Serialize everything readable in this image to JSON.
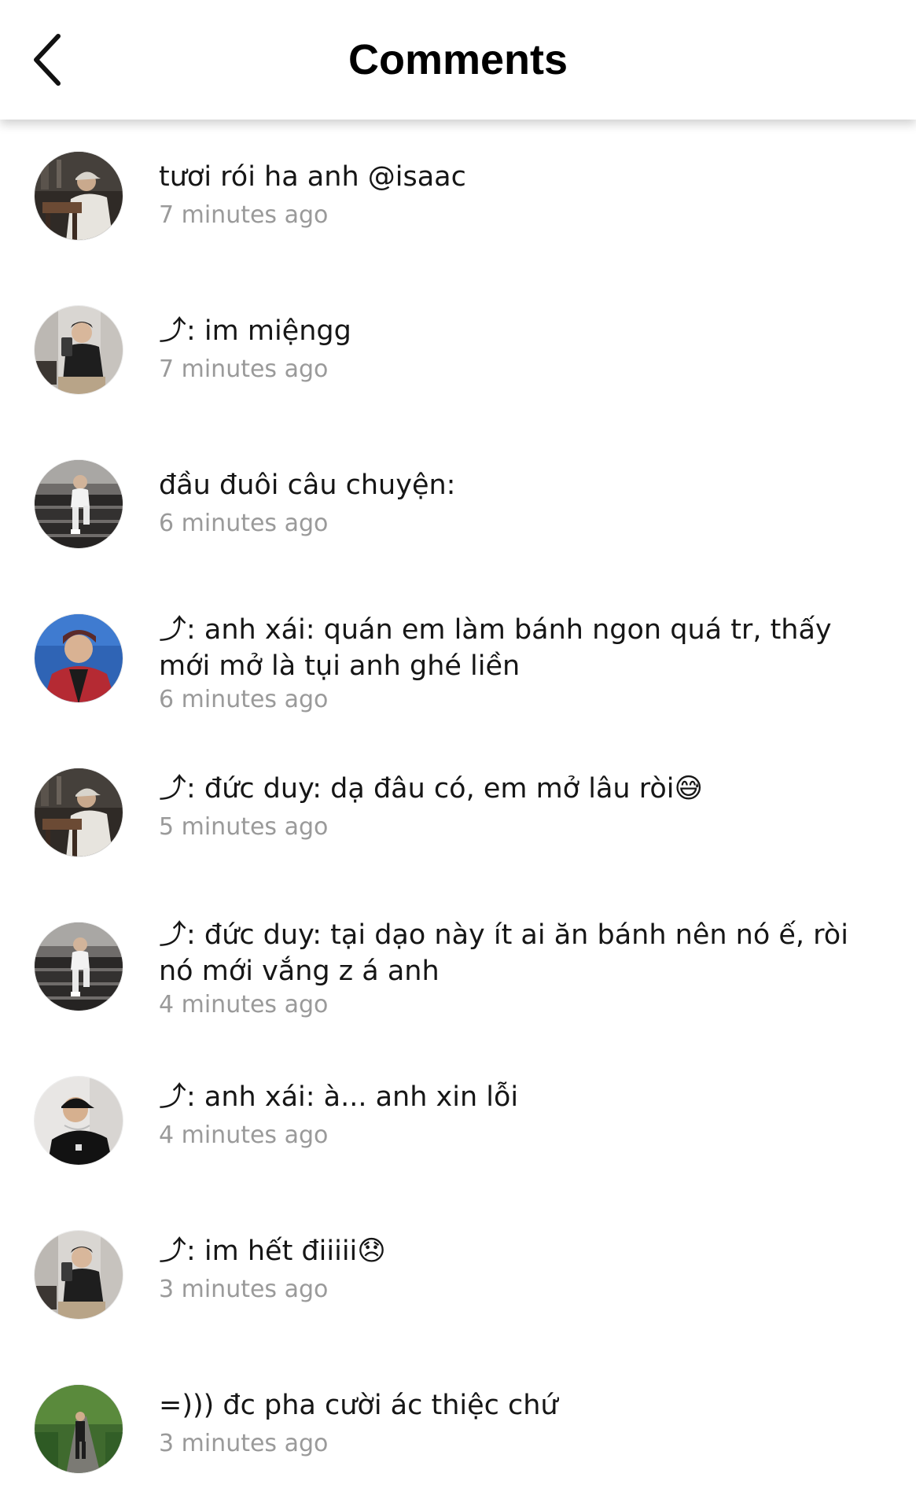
{
  "header": {
    "title": "Comments",
    "back_icon": "chevron-left-icon"
  },
  "comments": [
    {
      "text": "tươi rói ha anh @isaac",
      "time": "7 minutes ago",
      "avatar": "photo-man-cap-studio"
    },
    {
      "text": "⤴: im miệngg",
      "time": "7 minutes ago",
      "avatar": "photo-man-mirror-selfie"
    },
    {
      "text": "đầu đuôi câu chuyện:",
      "time": "6 minutes ago",
      "avatar": "photo-man-on-stairs"
    },
    {
      "text": "⤴: anh xái: quán em làm bánh ngon quá tr, thấy mới mở là tụi anh ghé liền",
      "time": "6 minutes ago",
      "avatar": "photo-man-red-jacket"
    },
    {
      "text": "⤴: đức duy: dạ đâu có, em mở lâu ròi😅",
      "time": "5 minutes ago",
      "avatar": "photo-man-cap-studio"
    },
    {
      "text": "⤴: đức duy: tại dạo này ít ai ăn bánh nên nó ế, ròi nó mới vắng z á anh",
      "time": "4 minutes ago",
      "avatar": "photo-man-on-stairs"
    },
    {
      "text": "⤴: anh xái: à... anh xin lỗi",
      "time": "4 minutes ago",
      "avatar": "photo-man-black-cap"
    },
    {
      "text": "⤴: im hết điiiii😞",
      "time": "3 minutes ago",
      "avatar": "photo-man-mirror-selfie"
    },
    {
      "text": "=))) đc pha cười ác thiệc chứ",
      "time": "3 minutes ago",
      "avatar": "photo-man-park-path"
    }
  ]
}
